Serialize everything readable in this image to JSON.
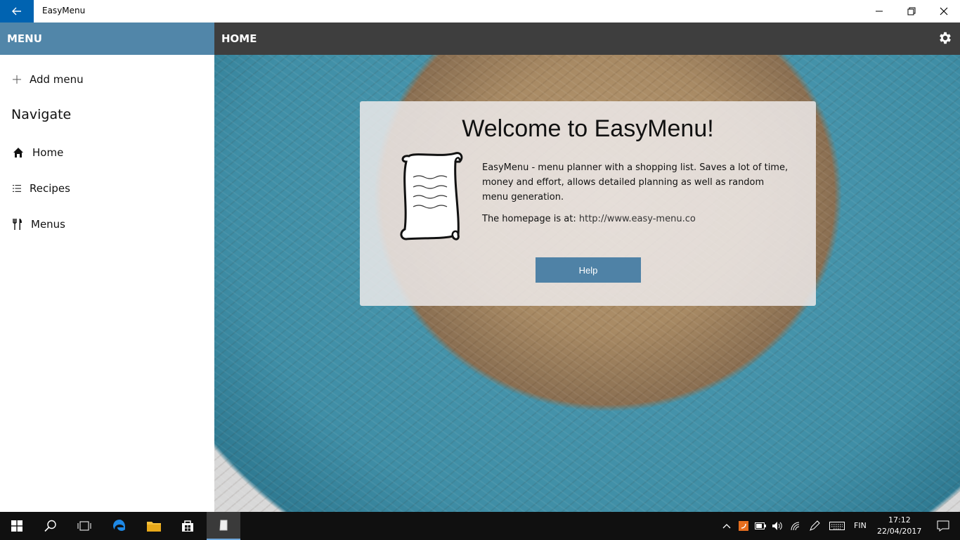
{
  "titlebar": {
    "app_title": "EasyMenu"
  },
  "sidebar": {
    "header": "MENU",
    "add_menu": "Add menu",
    "section_title": "Navigate",
    "items": [
      {
        "label": "Home",
        "icon": "home-icon"
      },
      {
        "label": "Recipes",
        "icon": "list-icon"
      },
      {
        "label": "Menus",
        "icon": "cutlery-icon"
      }
    ]
  },
  "main": {
    "header": "HOME",
    "card": {
      "title": "Welcome to EasyMenu!",
      "description": "EasyMenu - menu planner with a shopping list. Saves a lot of time, money and effort, allows detailed planning as well as random menu generation.",
      "homepage_label": "The homepage is at:",
      "homepage_url": "http://www.easy-menu.co",
      "help_button": "Help"
    }
  },
  "taskbar": {
    "language": "FIN",
    "time": "17:12",
    "date": "22/04/2017"
  },
  "colors": {
    "sidebar_header": "#5186a9",
    "main_header": "#3e3e3e",
    "back_button": "#0063b1",
    "help_button": "#4f82a6"
  }
}
